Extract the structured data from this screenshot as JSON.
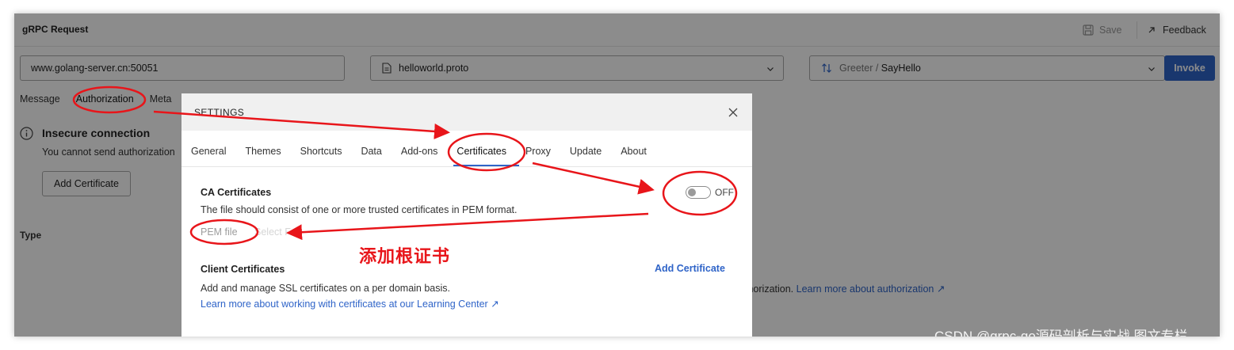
{
  "app": {
    "title": "gRPC Request",
    "save_label": "Save",
    "feedback_label": "Feedback",
    "url_value": "www.golang-server.cn:50051",
    "proto_value": "helloworld.proto",
    "method_service": "Greeter / ",
    "method_name": "SayHello",
    "invoke_label": "Invoke",
    "tabs": [
      "Message",
      "Authorization",
      "Meta"
    ],
    "warning_title": "Insecure connection",
    "warning_text": "You cannot send authorization",
    "add_certificate_label": "Add Certificate",
    "type_label": "Type",
    "bg_text_prefix": "thorization.",
    "bg_link": "Learn more about authorization ↗"
  },
  "settings": {
    "title": "SETTINGS",
    "tabs": [
      "General",
      "Themes",
      "Shortcuts",
      "Data",
      "Add-ons",
      "Certificates",
      "Proxy",
      "Update",
      "About"
    ],
    "active_tab": "Certificates",
    "ca": {
      "title": "CA Certificates",
      "description": "The file should consist of one or more trusted certificates in PEM format.",
      "toggle_label": "OFF",
      "toggle_on": false,
      "pem_label": "PEM file",
      "select_file_label": "Select F"
    },
    "client": {
      "title": "Client Certificates",
      "description": "Add and manage SSL certificates on a per domain basis.",
      "learn_link": "Learn more about working with certificates at our Learning Center ↗",
      "add_label": "Add Certificate"
    }
  },
  "annotation": {
    "text": "添加根证书",
    "color": "#e8151a"
  },
  "watermark": "CSDN @grpc-go源码剖析与实战 图文专栏"
}
